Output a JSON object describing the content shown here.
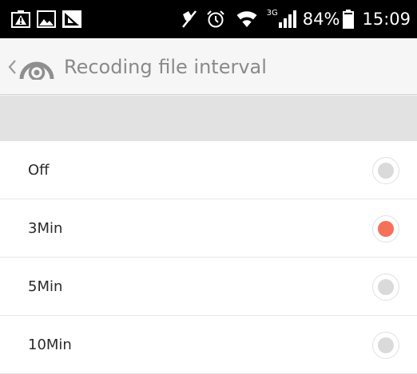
{
  "status_bar": {
    "left_icons": [
      "battery-saver-icon",
      "image-notification-icon",
      "app-notification-icon"
    ],
    "right_icons": [
      "mute-icon",
      "alarm-icon",
      "wifi-icon",
      "signal-icon"
    ],
    "network_type": "3G",
    "battery_percent": "84%",
    "battery_level": 0.84,
    "time": "15:09"
  },
  "header": {
    "back_icon": "chevron-left-icon",
    "app_icon": "camera-lens-icon",
    "title": "Recoding file interval"
  },
  "options": [
    {
      "label": "Off",
      "selected": false
    },
    {
      "label": "3Min",
      "selected": true
    },
    {
      "label": "5Min",
      "selected": false
    },
    {
      "label": "10Min",
      "selected": false
    }
  ],
  "colors": {
    "status_bar_bg": "#000000",
    "header_bg": "#f6f6f6",
    "band_bg": "#e2e2e2",
    "title_text": "#8a8a8a",
    "option_text": "#2a2a2a",
    "radio_selected": "#f4715a",
    "radio_unselected": "#dadada"
  }
}
